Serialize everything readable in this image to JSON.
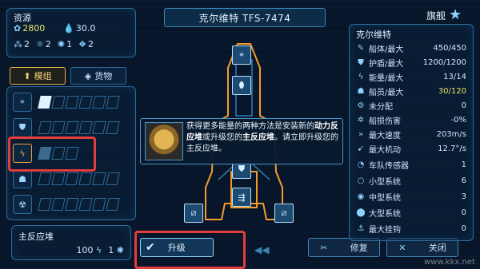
{
  "header": {
    "ship_name": "克尔维特 TFS-7474",
    "flag_label": "旗舰",
    "flag_icon": "star-icon"
  },
  "resources": {
    "title": "资源",
    "credits": "2800",
    "fuel": "30.0",
    "items": [
      "2",
      "2",
      "1",
      "2"
    ]
  },
  "tabs": [
    {
      "label": "模组",
      "icon": "upload-icon",
      "active": true
    },
    {
      "label": "货物",
      "icon": "cube-icon",
      "active": false
    }
  ],
  "modules": [
    {
      "icon": "weapon-icon",
      "level": 1
    },
    {
      "icon": "shield-icon",
      "level": 0
    },
    {
      "icon": "energy-icon",
      "level": 1,
      "highlighted": true
    },
    {
      "icon": "crew-icon",
      "level": 0
    },
    {
      "icon": "radiation-icon",
      "level": 0
    }
  ],
  "reactor": {
    "name": "主反应堆",
    "power": "100",
    "count": "1"
  },
  "tooltip": {
    "part1": "获得更多能量的两种方法是安装新的",
    "bold1": "动力反应堆",
    "part2": "或升级您的",
    "bold2": "主反应堆",
    "part3": "。请立即升级您的主反应堆。"
  },
  "buttons": {
    "upgrade": "升级",
    "repair": "修复",
    "close": "关闭"
  },
  "stats": {
    "title": "克尔维特",
    "rows": [
      {
        "label": "船体/最大",
        "value": "450/450",
        "icon": "hull-icon"
      },
      {
        "label": "护盾/最大",
        "value": "1200/1200",
        "icon": "shield-icon"
      },
      {
        "label": "能量/最大",
        "value": "13/14",
        "icon": "energy-icon"
      },
      {
        "label": "船员/最大",
        "value": "30/120",
        "icon": "crew-icon",
        "highlight": true
      },
      {
        "label": "未分配",
        "value": "0",
        "icon": "gear-icon"
      },
      {
        "label": "船损伤害",
        "value": "-0%",
        "icon": "damage-icon"
      },
      {
        "label": "最大速度",
        "value": "203m/s",
        "icon": "speed-icon"
      },
      {
        "label": "最大机动",
        "value": "12.7°/s",
        "icon": "maneuver-icon"
      },
      {
        "label": "车队传感器",
        "value": "1",
        "icon": "sensor-icon"
      },
      {
        "label": "小型系统",
        "value": "6",
        "icon": "small-system-icon"
      },
      {
        "label": "中型系统",
        "value": "3",
        "icon": "medium-system-icon"
      },
      {
        "label": "大型系统",
        "value": "0",
        "icon": "large-system-icon"
      },
      {
        "label": "最大挂钩",
        "value": "0",
        "icon": "hook-icon"
      }
    ]
  },
  "watermark": "www.kkx.net"
}
